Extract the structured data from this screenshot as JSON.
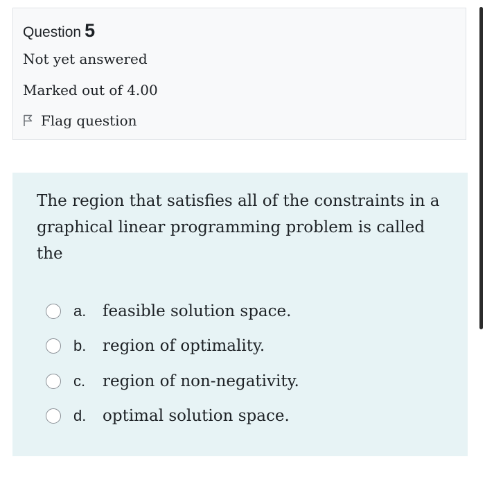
{
  "question": {
    "label": "Question",
    "number": "5",
    "state": "Not yet answered",
    "grade": "Marked out of 4.00",
    "flag_label": "Flag question"
  },
  "prompt": "The region that satisfies all of the constraints in a graphical linear programming problem is called the",
  "answers": [
    {
      "letter": "a.",
      "text": "feasible solution space."
    },
    {
      "letter": "b.",
      "text": "region of optimality."
    },
    {
      "letter": "c.",
      "text": "region of non-negativity."
    },
    {
      "letter": "d.",
      "text": "optimal solution space."
    }
  ],
  "colors": {
    "info_bg": "#f8f9fa",
    "question_bg": "#e7f3f5",
    "text": "#1d2125"
  },
  "icons": {
    "flag": "flag-icon",
    "radio": "radio-unchecked-icon"
  }
}
